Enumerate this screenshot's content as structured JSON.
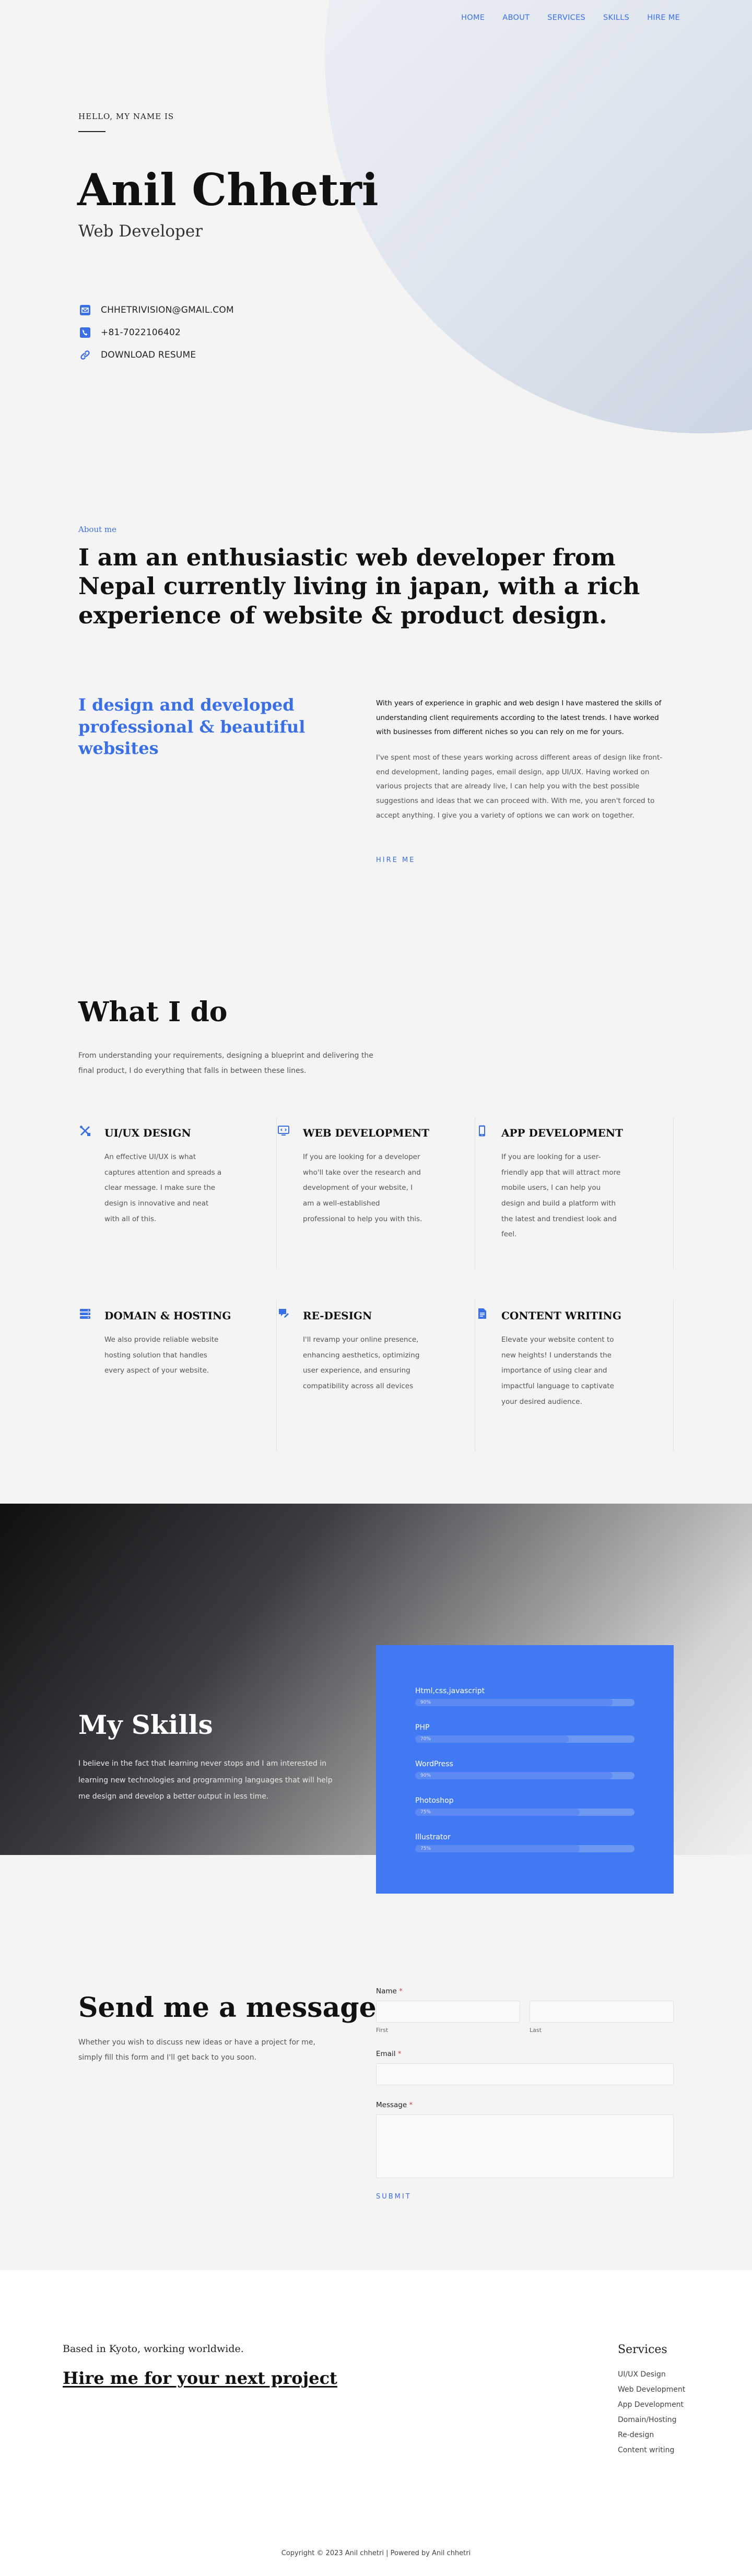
{
  "nav": {
    "items": [
      "HOME",
      "ABOUT",
      "SERVICES",
      "SKILLS",
      "HIRE ME"
    ]
  },
  "hero": {
    "greeting": "HELLO, MY NAME IS",
    "name": "Anil Chhetri",
    "role": "Web Developer",
    "contacts": [
      {
        "icon": "email-icon",
        "text": "CHHETRIVISION@GMAIL.COM"
      },
      {
        "icon": "phone-icon",
        "text": "+81-7022106402"
      },
      {
        "icon": "link-icon",
        "text": "DOWNLOAD RESUME"
      }
    ]
  },
  "about": {
    "kicker": "About me",
    "headline": "I am an enthusiastic web developer from Nepal currently living in japan, with a rich experience of website & product design.",
    "subheading": "I design and developed professional & beautiful websites",
    "paragraph1": "With years of experience in graphic and web design I have mastered the skills of understanding client requirements according to the latest trends. I have worked with businesses from different niches so you can rely on me for yours.",
    "paragraph2": "I've spent most of these years working across different areas of design like front-end development, landing pages, email design, app UI/UX. Having worked on various projects that are already live, I can help you with the best possible suggestions and ideas that we can proceed with. With me, you aren't forced to accept anything. I give you a variety of options we can work on together.",
    "cta": "HIRE ME"
  },
  "services": {
    "title": "What I do",
    "subtitle": "From understanding your requirements, designing a blueprint and delivering the final product, I do everything that falls in between these lines.",
    "items": [
      {
        "icon": "design-tools-icon",
        "title": "UI/UX DESIGN",
        "desc": "An effective UI/UX is what captures attention and spreads a clear message. I make sure the design is innovative and neat with all of this."
      },
      {
        "icon": "monitor-code-icon",
        "title": "WEB DEVELOPMENT",
        "desc": "If you are looking for a developer who'll take over the research and development of your website, I am a well-established professional to help you with this."
      },
      {
        "icon": "mobile-icon",
        "title": "APP DEVELOPMENT",
        "desc": "If you are looking for a user-friendly app that will attract more mobile users, I can help you design and build a platform with the latest and trendiest look and feel."
      },
      {
        "icon": "server-icon",
        "title": "DOMAIN & HOSTING",
        "desc": "We also provide reliable website hosting solution that handles every aspect of your website."
      },
      {
        "icon": "redesign-icon",
        "title": "RE-DESIGN",
        "desc": "I'll revamp your online presence, enhancing aesthetics, optimizing user experience, and ensuring compatibility across all devices"
      },
      {
        "icon": "document-icon",
        "title": "CONTENT WRITING",
        "desc": "Elevate your website content to new heights! I understands the importance of using clear and impactful language to captivate your desired audience."
      }
    ]
  },
  "skills": {
    "title": "My Skills",
    "subtitle": "I believe in the fact that learning never stops and I am interested in learning new technologies and programming languages that will help me design and develop a better output in less time.",
    "items": [
      {
        "name": "Html,css,javascript",
        "percent": 90,
        "label": "90%"
      },
      {
        "name": "PHP",
        "percent": 70,
        "label": "70%"
      },
      {
        "name": "WordPress",
        "percent": 90,
        "label": "90%"
      },
      {
        "name": "Photoshop",
        "percent": 75,
        "label": "75%"
      },
      {
        "name": "Illustrator",
        "percent": 75,
        "label": "75%"
      }
    ]
  },
  "contact": {
    "title": "Send me a message",
    "subtitle": "Whether you wish to discuss new ideas or have a project for me, simply fill this form and I'll get back to you soon.",
    "name_label": "Name",
    "required_mark": "*",
    "first_hint": "First",
    "last_hint": "Last",
    "email_label": "Email",
    "message_label": "Message",
    "submit": "SUBMIT"
  },
  "footer": {
    "based": "Based in Kyoto, working worldwide.",
    "cta": "Hire me for your next project",
    "services_title": "Services",
    "services": [
      "UI/UX Design",
      "Web Development",
      "App Development",
      "Domain/Hosting",
      "Re-design",
      "Content writing"
    ],
    "copyright": "Copyright © 2023 Anil chhetri | Powered by Anil chhetri"
  },
  "colors": {
    "accent": "#3b6fe6",
    "skills_card": "#4179f5",
    "background": "#f3f4f3"
  }
}
